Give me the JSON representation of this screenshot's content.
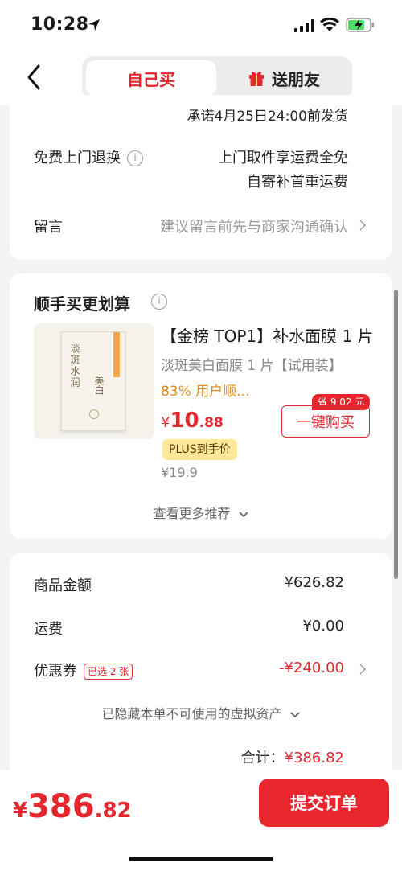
{
  "status_bar": {
    "time": "10:28",
    "icons": [
      "location-arrow-icon",
      "signal-icon",
      "wifi-icon",
      "battery-charging-icon"
    ]
  },
  "nav": {
    "tabs": [
      {
        "label": "自己买",
        "selected": true
      },
      {
        "label": "送朋友",
        "selected": false,
        "icon": "gift-icon"
      }
    ]
  },
  "delivery": {
    "promise": "承诺4月25日24:00前发货",
    "return_label": "免费上门退换",
    "return_line1": "上门取件享运费全免",
    "return_line2": "自寄补首重运费",
    "message_label": "留言",
    "message_placeholder": "建议留言前先与商家沟通确认"
  },
  "recommend": {
    "title": "顺手买更划算",
    "product": {
      "name": "【金榜 TOP1】补水面膜 1 片",
      "subtitle": "淡斑美白面膜 1 片【试用装】",
      "stat": "83% 用户顺...",
      "price_symbol": "¥",
      "price_int": "10",
      "price_dec": ".88",
      "plus_label": "PLUS到手价",
      "original_price": "¥19.9",
      "save_badge": "省 9.02 元",
      "buy_button": "一键购买",
      "pack_text1": "淡斑水润",
      "pack_text2": "美白"
    },
    "more_label": "查看更多推荐"
  },
  "summary": {
    "goods_label": "商品金额",
    "goods_value": "¥626.82",
    "shipping_label": "运费",
    "shipping_value": "¥0.00",
    "coupon_label": "优惠券",
    "coupon_tag": "已选 2 张",
    "coupon_value": "-¥240.00",
    "hidden_note": "已隐藏本单不可使用的虚拟资产",
    "total_label": "合计：",
    "total_value": "¥386.82"
  },
  "bottom": {
    "price_symbol": "¥",
    "price_int": "386",
    "price_dec": ".82",
    "submit_label": "提交订单"
  },
  "colors": {
    "accent": "#e4262d",
    "orange": "#e08a1e",
    "plus_bg": "#fde89a"
  }
}
